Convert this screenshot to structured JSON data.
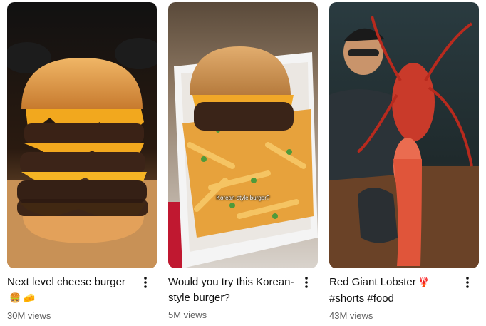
{
  "shorts": [
    {
      "title": "Next level cheese burger",
      "emojis": "🍔 🧀",
      "views": "30M views"
    },
    {
      "title": "Would you try this Korean-style burger?",
      "emojis": "",
      "overlay_caption": "Korean-style burger?",
      "views": "5M views"
    },
    {
      "title": "Red Giant Lobster",
      "emojis": "🦞",
      "title_line2": "#shorts #food",
      "views": "43M views"
    }
  ],
  "icons": {
    "more": "more-vert-icon"
  }
}
